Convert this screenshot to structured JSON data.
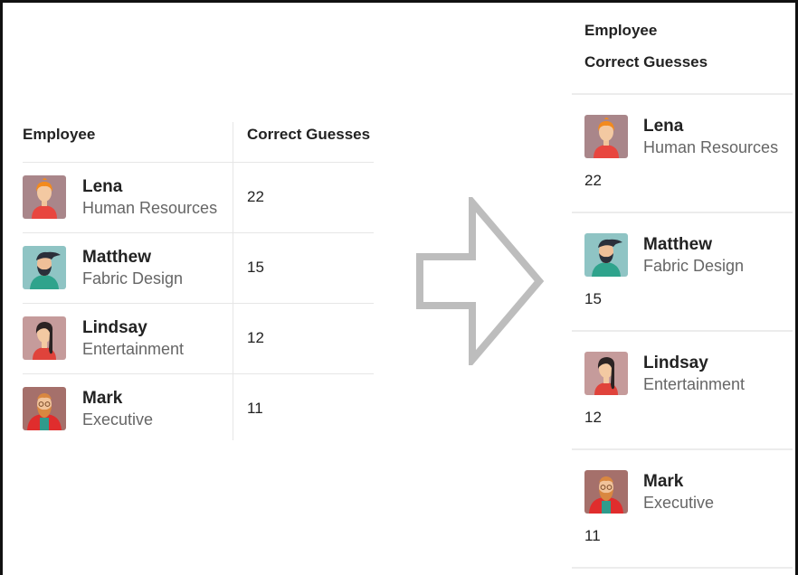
{
  "table": {
    "header_employee": "Employee",
    "header_score": "Correct Guesses"
  },
  "employees": [
    {
      "name": "Lena",
      "department": "Human Resources",
      "score": "22",
      "avatar": "woman-redhead-avatar"
    },
    {
      "name": "Matthew",
      "department": "Fabric Design",
      "score": "15",
      "avatar": "man-beard-teal-avatar"
    },
    {
      "name": "Lindsay",
      "department": "Entertainment",
      "score": "12",
      "avatar": "woman-dark-hair-avatar"
    },
    {
      "name": "Mark",
      "department": "Executive",
      "score": "11",
      "avatar": "man-red-beard-avatar"
    }
  ],
  "arrow_icon": "right-arrow-icon",
  "colors": {
    "muted_text": "#666666",
    "divider": "#e6e6e6",
    "arrow": "#bdbdbd"
  }
}
